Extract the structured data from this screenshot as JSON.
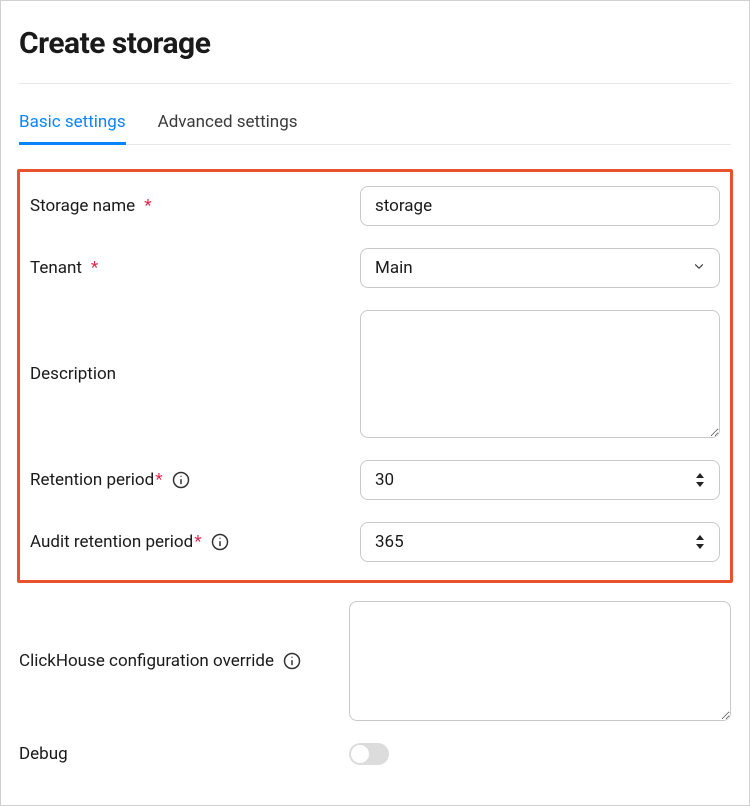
{
  "title": "Create storage",
  "tabs": [
    {
      "label": "Basic settings",
      "active": true
    },
    {
      "label": "Advanced settings",
      "active": false
    }
  ],
  "fields": {
    "storage_name": {
      "label": "Storage name",
      "required": true,
      "value": "storage"
    },
    "tenant": {
      "label": "Tenant",
      "required": true,
      "value": "Main"
    },
    "description": {
      "label": "Description",
      "required": false,
      "value": ""
    },
    "retention_period": {
      "label": "Retention period",
      "required": true,
      "info": true,
      "value": "30"
    },
    "audit_retention_period": {
      "label": "Audit retention period",
      "required": true,
      "info": true,
      "value": "365"
    },
    "clickhouse_override": {
      "label": "ClickHouse configuration override",
      "required": false,
      "info": true,
      "value": ""
    },
    "debug": {
      "label": "Debug",
      "required": false,
      "value": false
    }
  }
}
